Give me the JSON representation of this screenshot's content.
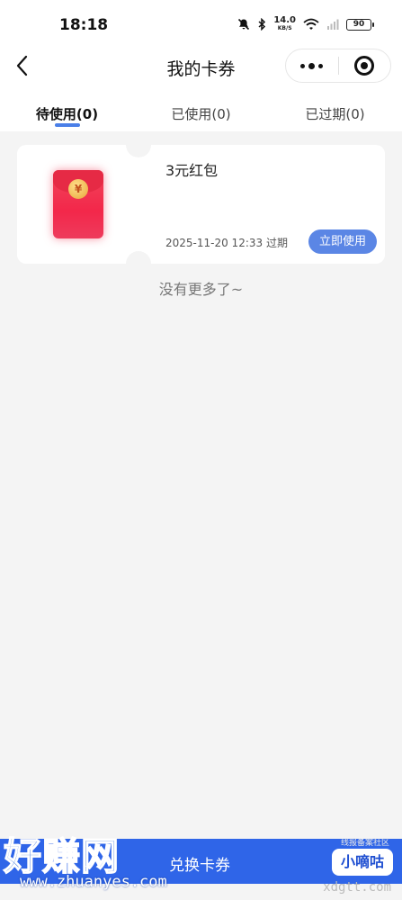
{
  "status_bar": {
    "time": "18:18",
    "network_speed": "14.0",
    "network_unit": "KB/S",
    "battery": "90",
    "icons": [
      "mute-icon",
      "bluetooth-icon",
      "wifi-icon",
      "signal-icon",
      "battery-icon"
    ]
  },
  "nav": {
    "title": "我的卡券",
    "back_icon": "chevron-left-icon",
    "more_icon": "more-dots-icon",
    "close_icon": "target-close-icon"
  },
  "tabs": [
    {
      "label": "待使用(0)",
      "active": true
    },
    {
      "label": "已使用(0)",
      "active": false
    },
    {
      "label": "已过期(0)",
      "active": false
    }
  ],
  "coupon": {
    "title": "3元红包",
    "expire": "2025-11-20 12:33 过期",
    "use_button": "立即使用",
    "coin_symbol": "¥",
    "image": "red-envelope-icon"
  },
  "list_end": "没有更多了~",
  "bottom": {
    "button_label": "兑换卡券"
  },
  "overlay": {
    "watermark_text": "好赚网",
    "watermark_url": "www.zhuanyes.com",
    "small_text": "线报备案社区",
    "brand_label": "小嘀咕",
    "site_text": "xdgtt.com"
  },
  "colors": {
    "accent": "#4a7fe8",
    "button": "#5b86e5",
    "bottom_bar": "#2f65e8",
    "background": "#f4f4f4"
  }
}
